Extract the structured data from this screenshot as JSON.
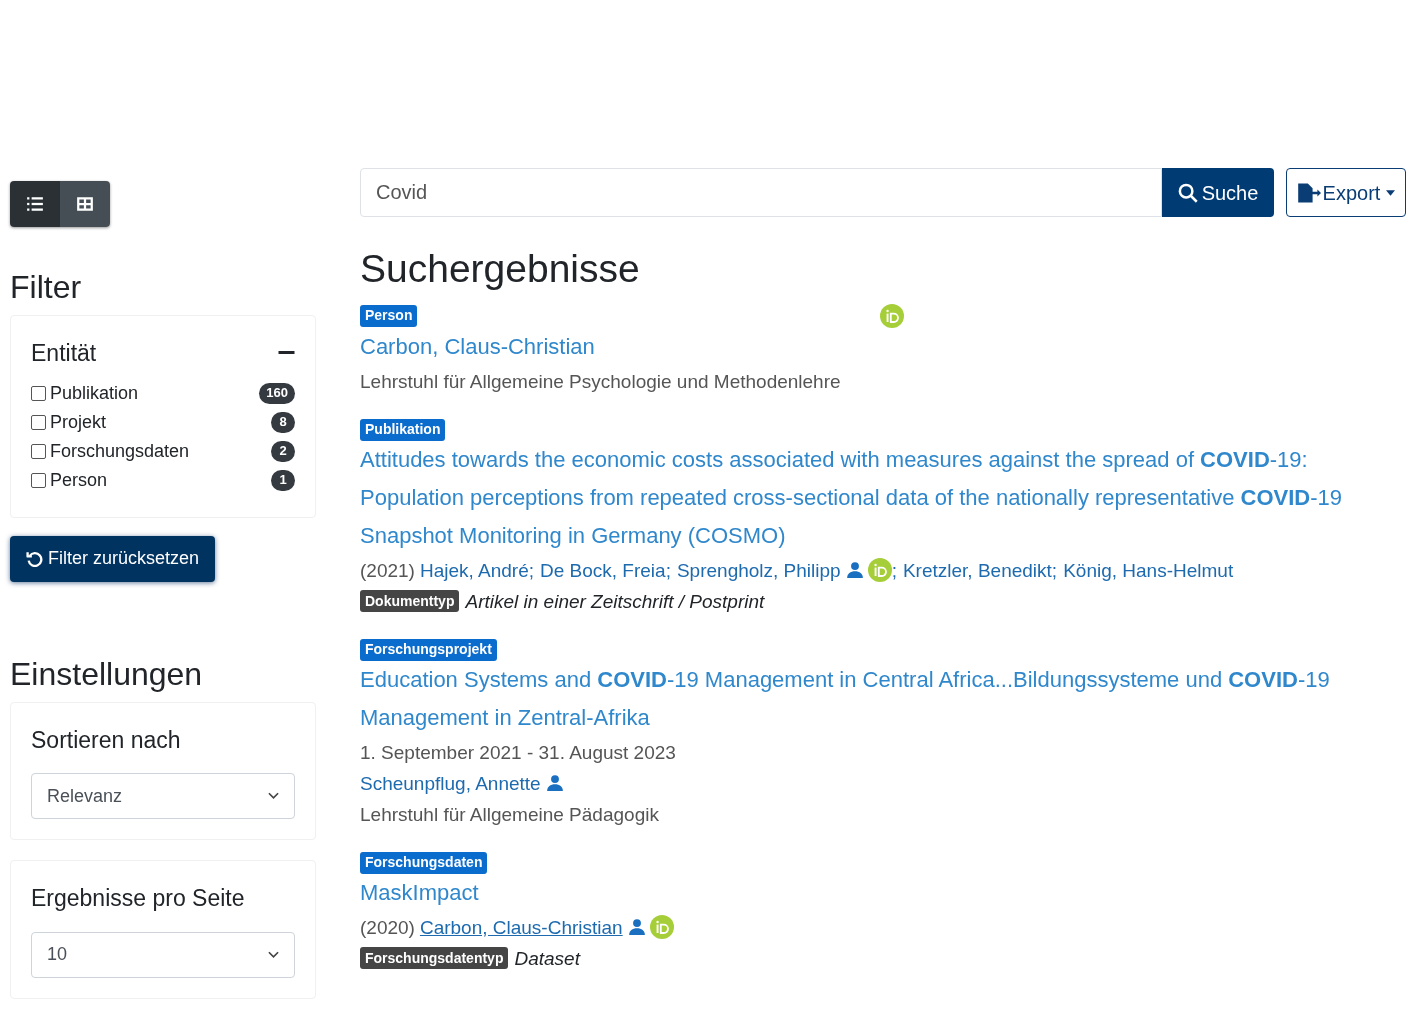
{
  "view_toggle": [
    {
      "kind": "list",
      "selected": true
    },
    {
      "kind": "grid",
      "selected": false
    }
  ],
  "filter": {
    "heading": "Filter",
    "group": {
      "title": "Entität",
      "expanded": true,
      "options": [
        {
          "label": "Publikation",
          "count": "160",
          "checked": false
        },
        {
          "label": "Projekt",
          "count": "8",
          "checked": false
        },
        {
          "label": "Forschungsdaten",
          "count": "2",
          "checked": false
        },
        {
          "label": "Person",
          "count": "1",
          "checked": false
        }
      ]
    },
    "reset_button": "Filter zurücksetzen"
  },
  "settings": {
    "heading": "Einstellungen",
    "selects": [
      {
        "label": "Sortieren nach",
        "value": "Relevanz"
      },
      {
        "label": "Ergebnisse pro Seite",
        "value": "10"
      }
    ]
  },
  "search": {
    "value": "Covid",
    "button": "Suche",
    "export_button": "Export"
  },
  "results_heading": "Suchergebnisse",
  "results": [
    {
      "badge": "Person",
      "id_icon": true,
      "title": "Carbon, Claus-Christian",
      "lines": [
        {
          "kind": "text",
          "text": "Lehrstuhl für Allgemeine Psychologie und Methodenlehre"
        }
      ]
    },
    {
      "badge": "Publikation",
      "id_icon": false,
      "title": "Attitudes towards the economic costs associated with measures against the spread of **COVID**-19: Population perceptions from repeated cross-sectional data of the nationally representative **COVID**-19 Snapshot Monitoring in Germany (COSMO)",
      "lines": [
        {
          "kind": "authors",
          "year": "(2021)",
          "authors": [
            {
              "name": "Hajek, André",
              "sep": ";",
              "person_icon": false,
              "id_icon": false,
              "underlined": false
            },
            {
              "name": "De Bock, Freia",
              "sep": ";",
              "person_icon": false,
              "id_icon": false,
              "underlined": false
            },
            {
              "name": "Sprengholz, Philipp",
              "sep": ";",
              "person_icon": true,
              "id_icon": true,
              "underlined": false
            },
            {
              "name": "Kretzler, Benedikt",
              "sep": ";",
              "person_icon": false,
              "id_icon": false,
              "underlined": false
            },
            {
              "name": "König, Hans-Helmut",
              "person_icon": false,
              "id_icon": false,
              "underlined": false
            }
          ]
        },
        {
          "kind": "type",
          "label": "Dokumenttyp",
          "value": "Artikel in einer Zeitschrift / Postprint"
        }
      ]
    },
    {
      "badge": "Forschungsprojekt",
      "id_icon": false,
      "title": "Education Systems and **COVID**-19 Management in Central Africa...Bildungssysteme und **COVID**-19 Management in Zentral-Afrika",
      "lines": [
        {
          "kind": "text",
          "text": "1. September 2021 - 31. August 2023"
        },
        {
          "kind": "authors",
          "authors": [
            {
              "name": "Scheunpflug, Annette",
              "person_icon": true,
              "id_icon": false,
              "underlined": false
            }
          ]
        },
        {
          "kind": "text",
          "text": "Lehrstuhl für Allgemeine Pädagogik"
        }
      ]
    },
    {
      "badge": "Forschungsdaten",
      "id_icon": false,
      "title": "MaskImpact",
      "lines": [
        {
          "kind": "authors",
          "year": "(2020)",
          "authors": [
            {
              "name": "Carbon, Claus-Christian",
              "person_icon": true,
              "id_icon": true,
              "underlined": true
            }
          ]
        },
        {
          "kind": "type",
          "label": "Forschungsdatentyp",
          "value": "Dataset"
        }
      ]
    }
  ]
}
